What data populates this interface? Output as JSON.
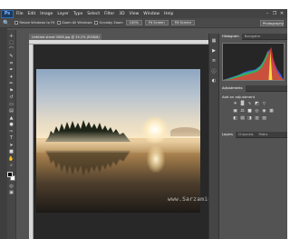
{
  "app": {
    "logo": "Ps",
    "menus": [
      "File",
      "Edit",
      "Image",
      "Layer",
      "Type",
      "Select",
      "Filter",
      "3D",
      "View",
      "Window",
      "Help"
    ],
    "window_controls": [
      "–",
      "❐",
      "✕"
    ]
  },
  "options": {
    "resize_windows_label": "Resize Windows to Fit",
    "zoom_all_windows_label": "Zoom All Windows",
    "scrubby_zoom_label": "Scrubby Zoom",
    "btn_100": "100%",
    "btn_fit": "Fit Screen",
    "btn_fill": "Fill Screen",
    "workspace": "Photography"
  },
  "document": {
    "tab_title": "Untitled sheet 0006.jpg @ 25.2% (RGB/8)"
  },
  "panels": {
    "histogram_tab": "Histogram",
    "navigator_tab": "Navigator",
    "adjustments_tab": "Adjustments",
    "add_adjustment": "Add an adjustment",
    "layers_tab": "Layers",
    "channels_tab": "Channels",
    "paths_tab": "Paths"
  },
  "watermark": "www.SarzaminDownload.com",
  "icons": {
    "tools": [
      "move-tool",
      "marquee-tool",
      "lasso-tool",
      "quick-selection-tool",
      "crop-tool",
      "eyedropper-tool",
      "healing-tool",
      "brush-tool",
      "clone-stamp-tool",
      "history-brush-tool",
      "eraser-tool",
      "gradient-tool",
      "blur-tool",
      "dodge-tool",
      "pen-tool",
      "type-tool",
      "path-selection-tool",
      "shape-tool",
      "hand-tool",
      "zoom-tool"
    ],
    "dock": [
      "history-icon",
      "actions-icon",
      "properties-icon",
      "info-icon",
      "color-icon"
    ]
  }
}
